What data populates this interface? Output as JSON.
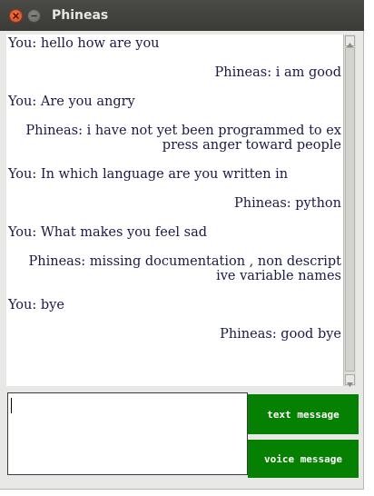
{
  "window": {
    "title": "Phineas"
  },
  "chat": {
    "messages": [
      {
        "sender": "user",
        "lines": [
          "You: hello how are you"
        ]
      },
      {
        "sender": "bot",
        "lines": [
          "Phineas: i am good"
        ]
      },
      {
        "sender": "user",
        "lines": [
          "You: Are you angry"
        ]
      },
      {
        "sender": "bot",
        "lines": [
          "Phineas: i have not yet been programmed to ex",
          "press anger toward people"
        ]
      },
      {
        "sender": "user",
        "lines": [
          "You: In which language are you written in"
        ]
      },
      {
        "sender": "bot",
        "lines": [
          "Phineas: python"
        ]
      },
      {
        "sender": "user",
        "lines": [
          "You: What makes you feel sad"
        ]
      },
      {
        "sender": "bot",
        "lines": [
          "Phineas: missing documentation , non descript",
          "ive variable names"
        ]
      },
      {
        "sender": "user",
        "lines": [
          "You: bye"
        ]
      },
      {
        "sender": "bot",
        "lines": [
          "Phineas: good bye"
        ]
      }
    ]
  },
  "input": {
    "value": ""
  },
  "buttons": {
    "text_label": "text message",
    "voice_label": "voice message"
  },
  "colors": {
    "button_green": "#058000",
    "title_bar": "#3f3f3c",
    "message_text": "#1a1a45"
  },
  "icons": {
    "close": "close-icon",
    "minimize": "minimize-icon"
  }
}
